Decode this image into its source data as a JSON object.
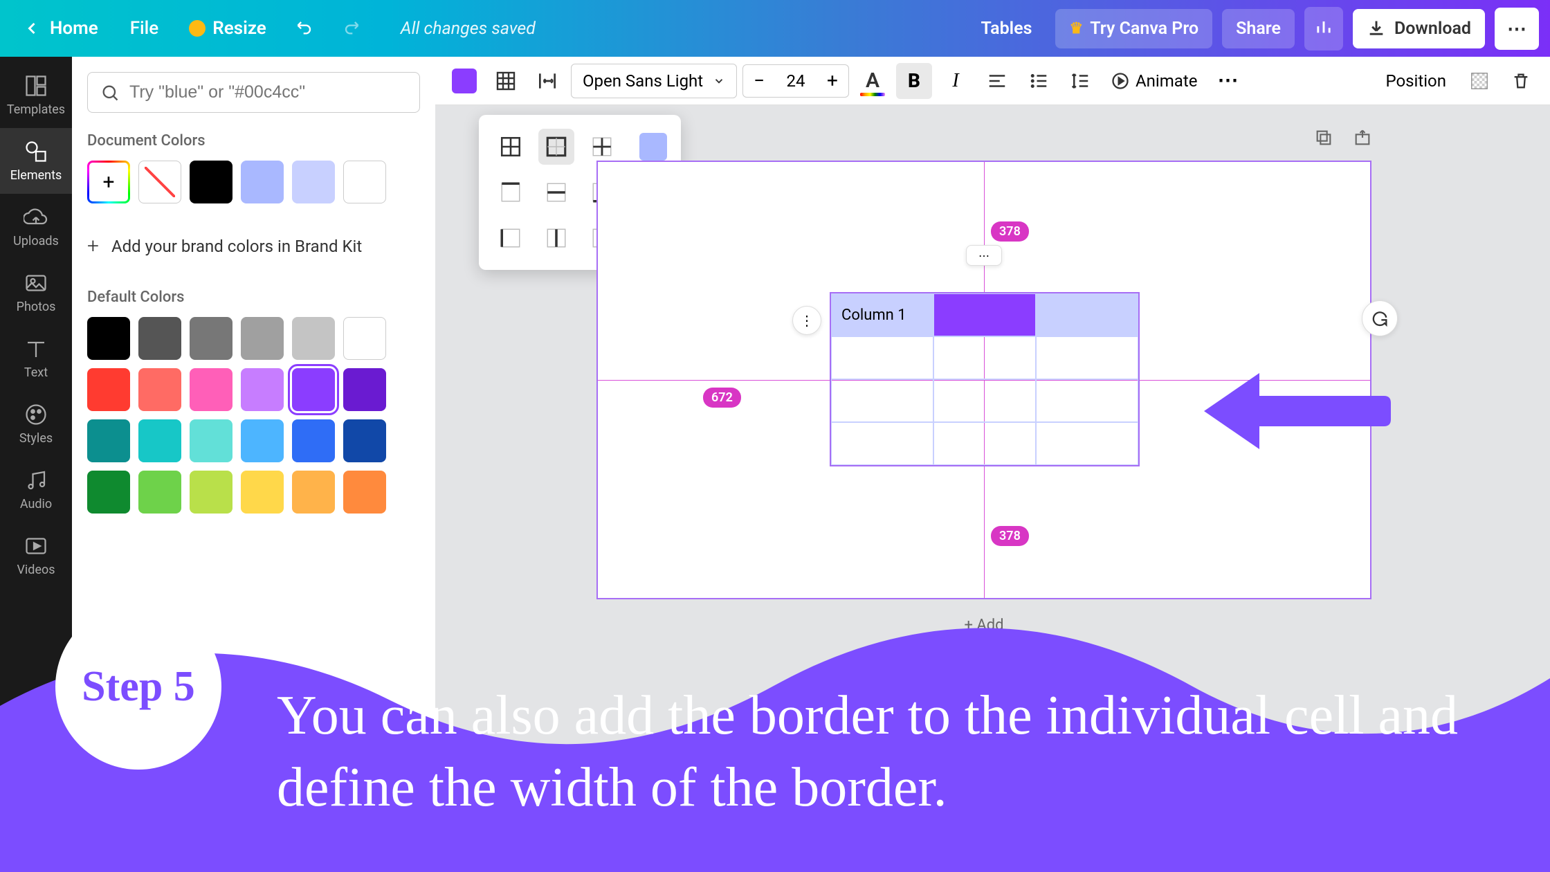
{
  "topbar": {
    "home": "Home",
    "file": "File",
    "resize": "Resize",
    "save_status": "All changes saved",
    "tables": "Tables",
    "try_pro": "Try Canva Pro",
    "share": "Share",
    "download": "Download"
  },
  "leftbar": {
    "templates": "Templates",
    "elements": "Elements",
    "uploads": "Uploads",
    "photos": "Photos",
    "text": "Text",
    "styles": "Styles",
    "audio": "Audio",
    "videos": "Videos"
  },
  "color_panel": {
    "search_placeholder": "Try \"blue\" or \"#00c4cc\"",
    "doc_colors_label": "Document Colors",
    "doc_colors": [
      "#000000",
      "#a9b8ff",
      "#c8d0ff",
      "#ffffff"
    ],
    "brand_kit": "Add your brand colors in Brand Kit",
    "default_label": "Default Colors",
    "default_colors": [
      [
        "#000000",
        "#555555",
        "#777777",
        "#a0a0a0",
        "#c4c4c4",
        "#ffffff"
      ],
      [
        "#ff3b30",
        "#ff6b64",
        "#ff5fb8",
        "#c77dff",
        "#8b3dff",
        "#6a1bd1"
      ],
      [
        "#0c8f8f",
        "#17c7c7",
        "#62e0d8",
        "#4db5ff",
        "#2f6df6",
        "#1148a8"
      ],
      [
        "#0f8a2f",
        "#6ed24a",
        "#b9e04a",
        "#ffd84a",
        "#ffb34a",
        "#ff8a3d"
      ]
    ],
    "selected_color": "#8b3dff"
  },
  "ctx_toolbar": {
    "font": "Open Sans Light",
    "font_size": "24",
    "animate": "Animate",
    "position": "Position"
  },
  "canvas": {
    "guide_top": "378",
    "guide_mid": "672",
    "guide_bottom": "378",
    "table_header_col1": "Column 1",
    "add_page": "+ Add"
  },
  "step": {
    "badge": "Step 5",
    "text": "You can also add the border to the individual cell and define the width of the border."
  }
}
